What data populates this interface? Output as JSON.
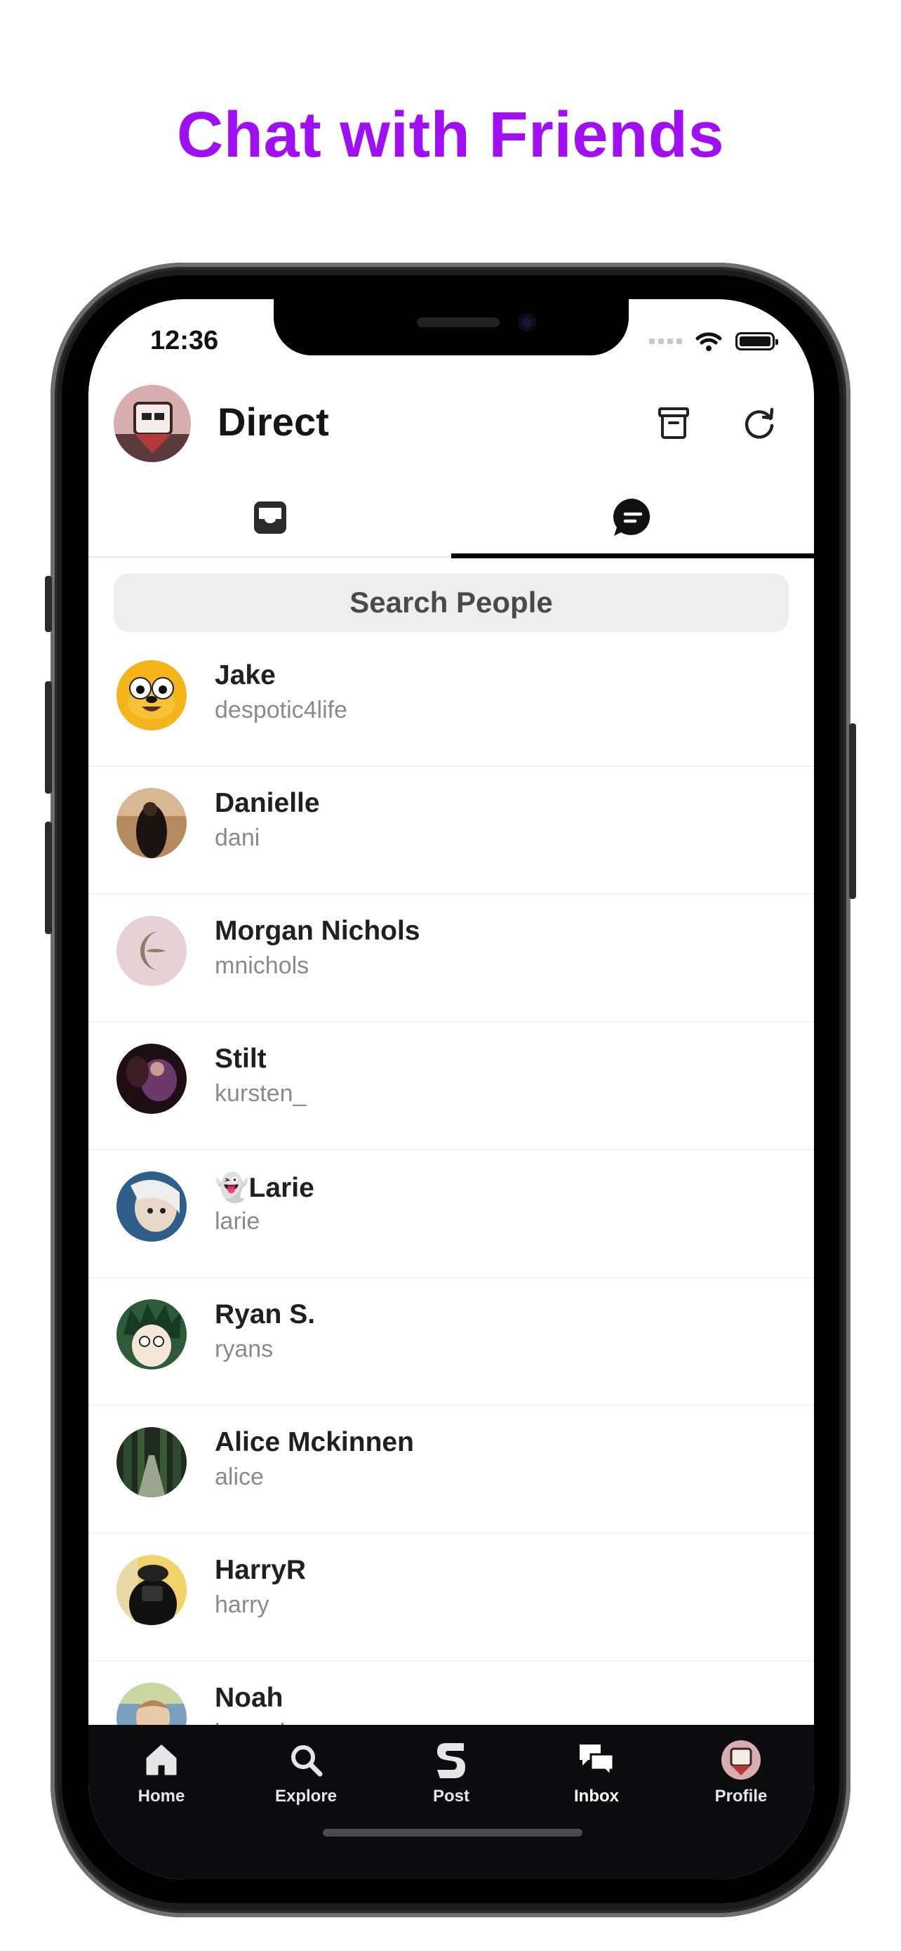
{
  "promo": {
    "headline": "Chat with Friends"
  },
  "status_bar": {
    "time": "12:36",
    "icons": [
      "cellular-signal-icon",
      "wifi-icon",
      "battery-icon"
    ],
    "battery_level": 1.0
  },
  "header": {
    "title": "Direct",
    "icons": [
      "archive-icon",
      "refresh-icon"
    ]
  },
  "tabs": [
    {
      "icon": "inbox-tray-icon",
      "selected": false
    },
    {
      "icon": "chat-bubble-icon",
      "selected": true
    }
  ],
  "search": {
    "placeholder": "Search People"
  },
  "contacts": [
    {
      "name": "Jake",
      "username": "despotic4life"
    },
    {
      "name": "Danielle",
      "username": "dani"
    },
    {
      "name": "Morgan Nichols",
      "username": "mnichols"
    },
    {
      "name": "Stilt",
      "username": "kursten_"
    },
    {
      "name": "👻Larie",
      "username": "larie"
    },
    {
      "name": "Ryan S.",
      "username": "ryans"
    },
    {
      "name": "Alice Mckinnen",
      "username": "alice"
    },
    {
      "name": "HarryR",
      "username": "harry"
    },
    {
      "name": "Noah",
      "username": "imnoah"
    }
  ],
  "tab_bar": {
    "items": [
      {
        "label": "Home",
        "icon": "home-icon"
      },
      {
        "label": "Explore",
        "icon": "search-icon"
      },
      {
        "label": "Post",
        "icon": "post-logo-icon"
      },
      {
        "label": "Inbox",
        "icon": "inbox-chat-icon"
      },
      {
        "label": "Profile",
        "icon": "profile-avatar-icon"
      }
    ]
  },
  "colors": {
    "accent": "#a00ef4",
    "tabbar_bg": "#0c0c0f"
  }
}
